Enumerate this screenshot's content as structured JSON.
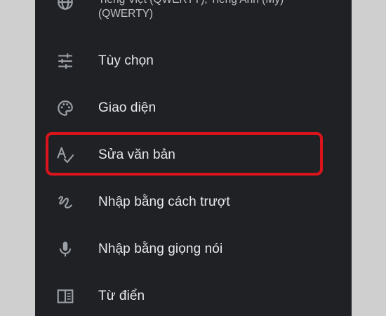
{
  "menu": {
    "top_item": {
      "line1": "Tiếng Việt (QWERTY), Tiếng Anh (Mỹ)",
      "line2": "(QWERTY)",
      "icon": "globe-icon"
    },
    "items": [
      {
        "label": "Tùy chọn",
        "icon": "tune-sliders-icon"
      },
      {
        "label": "Giao diện",
        "icon": "palette-icon"
      },
      {
        "label": "Sửa văn bản",
        "icon": "spellcheck-icon",
        "highlighted": true
      },
      {
        "label": "Nhập bằng cách trượt",
        "icon": "gesture-icon"
      },
      {
        "label": "Nhập bằng giọng nói",
        "icon": "microphone-icon"
      },
      {
        "label": "Từ điển",
        "icon": "dictionary-book-icon"
      }
    ]
  },
  "colors": {
    "background": "#202124",
    "text": "#e8eaed",
    "icon": "#9aa0a6",
    "highlight": "#d9141c",
    "outer": "#cfcfcf"
  }
}
